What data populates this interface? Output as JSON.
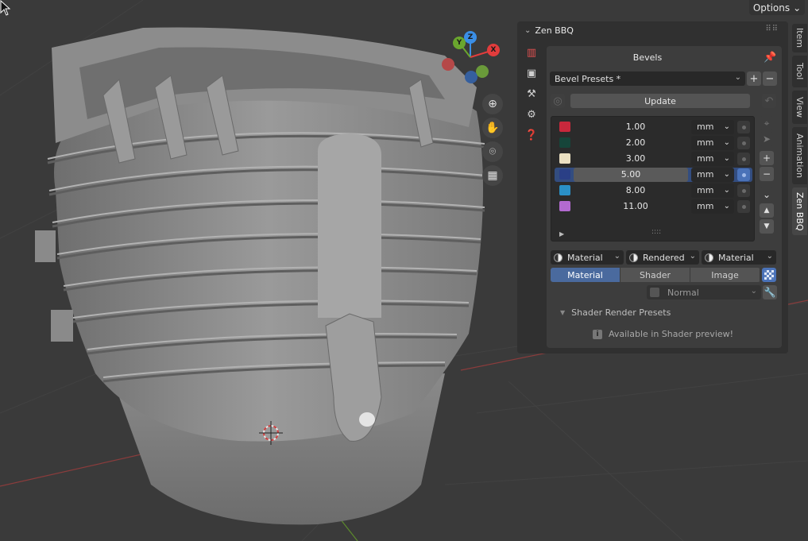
{
  "viewport": {
    "options_label": "Options",
    "gizmo": {
      "x": "X",
      "y": "Y",
      "z": "Z"
    },
    "nav_icons": [
      "zoom-icon",
      "hand-pan-icon",
      "camera-icon",
      "grid-icon"
    ]
  },
  "tabs": [
    "Item",
    "Tool",
    "View",
    "Animation",
    "Zen BBQ"
  ],
  "active_tab": "Zen BBQ",
  "panel": {
    "title": "Zen BBQ",
    "side_icons": [
      "bevels-icon",
      "images-icon",
      "tools-icon",
      "settings-icon",
      "help-icon"
    ],
    "section_title": "Bevels",
    "presets_label": "Bevel Presets *",
    "update_label": "Update",
    "bevels": [
      {
        "color": "#c8283c",
        "value": "1.00",
        "unit": "mm",
        "active": false
      },
      {
        "color": "#16453a",
        "value": "2.00",
        "unit": "mm",
        "active": false
      },
      {
        "color": "#ebe0c2",
        "value": "3.00",
        "unit": "mm",
        "active": false
      },
      {
        "color": "#2a3f86",
        "value": "5.00",
        "unit": "mm",
        "active": true
      },
      {
        "color": "#2a90c6",
        "value": "8.00",
        "unit": "mm",
        "active": false
      },
      {
        "color": "#b36ad0",
        "value": "11.00",
        "unit": "mm",
        "active": false
      }
    ],
    "shading": [
      "Material",
      "Rendered",
      "Material"
    ],
    "mode_tabs": [
      "Material",
      "Shader",
      "Image"
    ],
    "active_mode": "Material",
    "normal_label": "Normal",
    "shader_presets_label": "Shader Render Presets",
    "shader_info": "Available in Shader preview!"
  }
}
